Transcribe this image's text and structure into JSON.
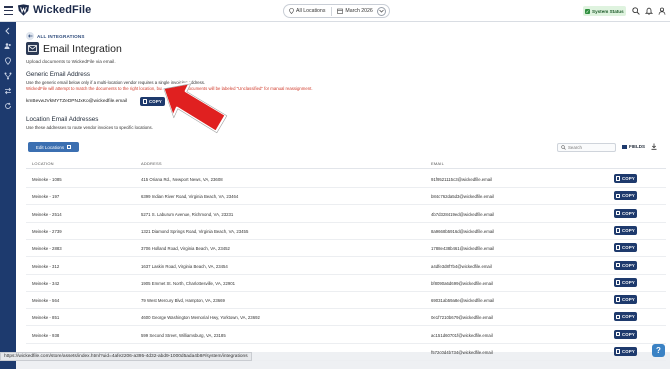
{
  "app": {
    "name": "WickedFile"
  },
  "header": {
    "location_filter": "All Locations",
    "date_filter": "March 2026",
    "system_status": "System Status"
  },
  "page": {
    "back_label": "ALL INTEGRATIONS",
    "title": "Email Integration",
    "subtitle": "Upload documents to WickedFile via email."
  },
  "generic": {
    "heading": "Generic Email Address",
    "description": "Use the generic email below only if a multi-location vendor requires a single invoicing address.",
    "warning": "WickedFile will attempt to match the documents to the right location, but unmatched documents will be labeled \"Unclassified\" for manual reassignment.",
    "email": "kmBevwJVkMYTZeDPNJxKo@wickedfile.email",
    "copy_label": "COPY"
  },
  "locations": {
    "heading": "Location Email Addresses",
    "description": "Use these addresses to route vendor invoices to specific locations.",
    "edit_label": "Edit Locations",
    "search_placeholder": "Search",
    "fields_label": "FIELDS",
    "columns": [
      "LOCATION",
      "ADDRESS",
      "EMAIL"
    ],
    "copy_label": "COPY",
    "rows": [
      {
        "location": "Meineke - 1085",
        "address": "415 Oriana Rd., Newport News, VA, 23608",
        "email": "91f9521115c3@wickedfile.email"
      },
      {
        "location": "Meineke - 197",
        "address": "6399 Indian River Road, Virginia Beach, VA, 23464",
        "email": "b84c762da5d3@wickedfile.email"
      },
      {
        "location": "Meineke - 2514",
        "address": "5271 S. Laburum Avenue, Richmond, VA, 23231",
        "email": "4b7d328419ed@wickedfile.email"
      },
      {
        "location": "Meineke - 2739",
        "address": "1321 Diamond Springs Road, Virginia Beach, VA, 23455",
        "email": "8a9668b5916d@wickedfile.email"
      },
      {
        "location": "Meineke - 2883",
        "address": "3706 Holland Road, Virginia Beach, VA, 23452",
        "email": "1788e438b461@wickedfile.email"
      },
      {
        "location": "Meineke - 312",
        "address": "1637 Laskin Road, Virginia Beach, VA, 23454",
        "email": "a4dfe3d8f7b4@wickedfile.email"
      },
      {
        "location": "Meineke - 342",
        "address": "1905 Emmet St. North, Charlottesville, VA, 22901",
        "email": "bf8090a6d699@wickedfile.email"
      },
      {
        "location": "Meineke - 564",
        "address": "79 West Mercury Blvd, Hampton, VA, 23669",
        "email": "69031ab59a8e@wickedfile.email"
      },
      {
        "location": "Meineke - 851",
        "address": "4600 George Washington Memorial Hwy, Yorktown, VA, 23692",
        "email": "0e1f7210b679@wickedfile.email"
      },
      {
        "location": "Meineke - 938",
        "address": "599 Second Street, Williamsburg, VA, 23185",
        "email": "ac151d60701f@wickedfile.email"
      },
      {
        "location": "",
        "address": "",
        "email": "f572c0d4b734@wickedfile.email"
      }
    ]
  },
  "status_bar": {
    "url": "https://wickedfile.com/store/assets/index.html?uid=4afe2206-a395-4d32-abd9-1000d5ada4b8#/system/integrations"
  },
  "help": {
    "label": "?"
  },
  "colors": {
    "primary": "#1e3a6d",
    "sidebar": "#1d3a6e",
    "warning": "#d13b2b",
    "arrow": "#e02020"
  }
}
